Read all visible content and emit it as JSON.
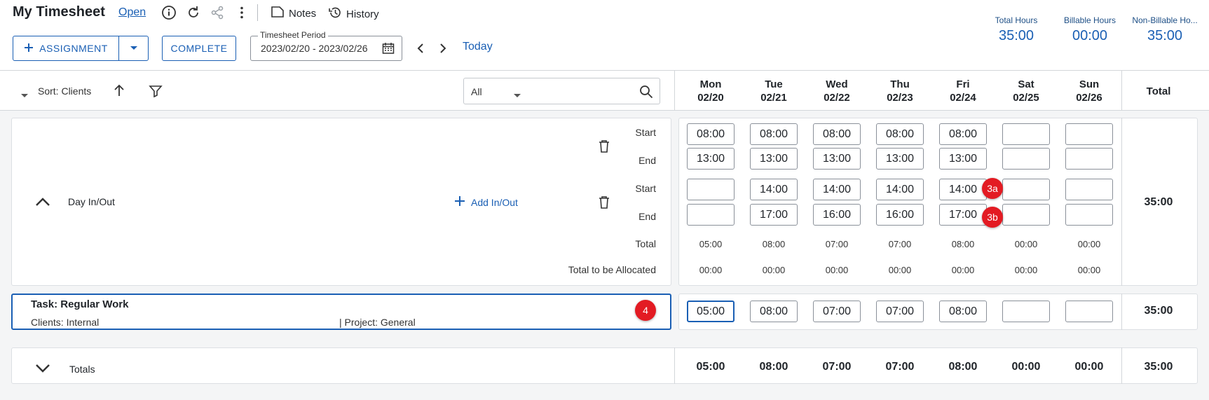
{
  "header": {
    "title": "My Timesheet",
    "status": "Open",
    "icons": [
      "info-icon",
      "refresh-icon",
      "share-icon",
      "more-vertical-icon"
    ],
    "notes_label": "Notes",
    "history_label": "History"
  },
  "toolbar": {
    "assignment_label": "ASSIGNMENT",
    "complete_label": "COMPLETE",
    "period_label": "Timesheet Period",
    "period_value": "2023/02/20 - 2023/02/26",
    "today_label": "Today"
  },
  "summary": {
    "total_hours_label": "Total Hours",
    "total_hours": "35:00",
    "billable_hours_label": "Billable Hours",
    "billable_hours": "00:00",
    "non_billable_hours_label": "Non-Billable Ho...",
    "non_billable_hours": "35:00"
  },
  "grid": {
    "sort_label": "Sort: Clients",
    "filter_value": "All",
    "total_header": "Total",
    "days": [
      {
        "name": "Mon",
        "date": "02/20"
      },
      {
        "name": "Tue",
        "date": "02/21"
      },
      {
        "name": "Wed",
        "date": "02/22"
      },
      {
        "name": "Thu",
        "date": "02/23"
      },
      {
        "name": "Fri",
        "date": "02/24"
      },
      {
        "name": "Sat",
        "date": "02/25"
      },
      {
        "name": "Sun",
        "date": "02/26"
      }
    ]
  },
  "day_inout": {
    "label": "Day In/Out",
    "add_label": "Add In/Out",
    "start_label": "Start",
    "end_label": "End",
    "total_label": "Total",
    "allocated_label": "Total to be Allocated",
    "start1": [
      "08:00",
      "08:00",
      "08:00",
      "08:00",
      "08:00",
      "",
      ""
    ],
    "end1": [
      "13:00",
      "13:00",
      "13:00",
      "13:00",
      "13:00",
      "",
      ""
    ],
    "start2": [
      "",
      "14:00",
      "14:00",
      "14:00",
      "14:00",
      "",
      ""
    ],
    "end2": [
      "",
      "17:00",
      "16:00",
      "16:00",
      "17:00",
      "",
      ""
    ],
    "totals": [
      "05:00",
      "08:00",
      "07:00",
      "07:00",
      "08:00",
      "00:00",
      "00:00"
    ],
    "allocated": [
      "00:00",
      "00:00",
      "00:00",
      "00:00",
      "00:00",
      "00:00",
      "00:00"
    ],
    "row_total": "35:00"
  },
  "task": {
    "title": "Task: Regular Work",
    "client": "Clients: Internal",
    "project": "|  Project: General",
    "hours": [
      "05:00",
      "08:00",
      "07:00",
      "07:00",
      "08:00",
      "",
      ""
    ],
    "row_total": "35:00"
  },
  "totals_row": {
    "label": "Totals",
    "values": [
      "05:00",
      "08:00",
      "07:00",
      "07:00",
      "08:00",
      "00:00",
      "00:00"
    ],
    "total": "35:00"
  },
  "badges": [
    "3a",
    "3b",
    "4"
  ],
  "colors": {
    "accent": "#1a5fb4",
    "badge": "#e31b23",
    "background": "#f4f5f6"
  }
}
